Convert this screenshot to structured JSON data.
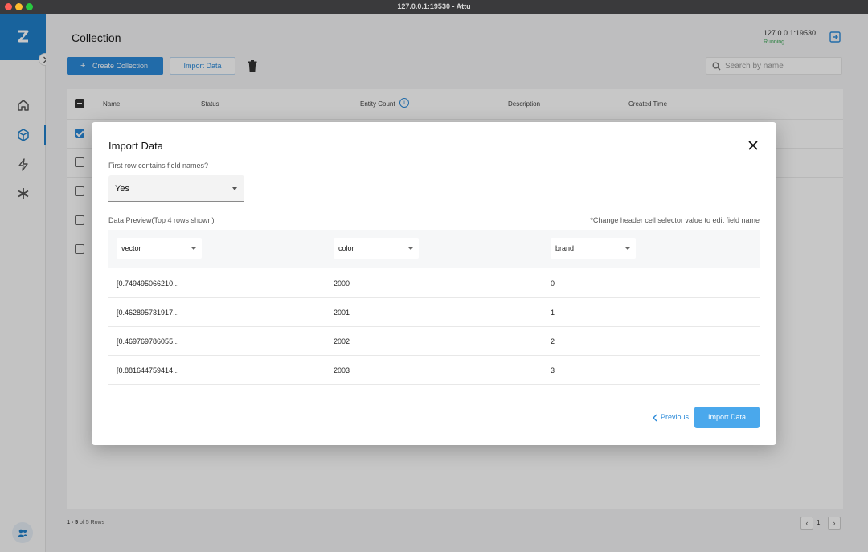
{
  "window": {
    "title": "127.0.0.1:19530 - Attu"
  },
  "header": {
    "page_title": "Collection",
    "server_address": "127.0.0.1:19530",
    "server_status": "Running"
  },
  "toolbar": {
    "create_label": "Create Collection",
    "import_label": "Import Data",
    "search_placeholder": "Search by name"
  },
  "table": {
    "columns": [
      "Name",
      "Status",
      "Entity Count",
      "Description",
      "Created Time"
    ]
  },
  "pagination": {
    "range": "1 - 5",
    "total": "of 5 Rows",
    "page": "1"
  },
  "dialog": {
    "title": "Import Data",
    "first_row_label": "First row contains field names?",
    "first_row_value": "Yes",
    "preview_label": "Data Preview(Top 4 rows shown)",
    "hint": "*Change header cell selector value to edit field name",
    "headers": [
      "vector",
      "color",
      "brand"
    ],
    "rows": [
      [
        "[0.749495066210...",
        "2000",
        "0"
      ],
      [
        "[0.462895731917...",
        "2001",
        "1"
      ],
      [
        "[0.469769786055...",
        "2002",
        "2"
      ],
      [
        "[0.881644759414...",
        "2003",
        "3"
      ]
    ],
    "previous_label": "Previous",
    "import_label": "Import Data"
  }
}
